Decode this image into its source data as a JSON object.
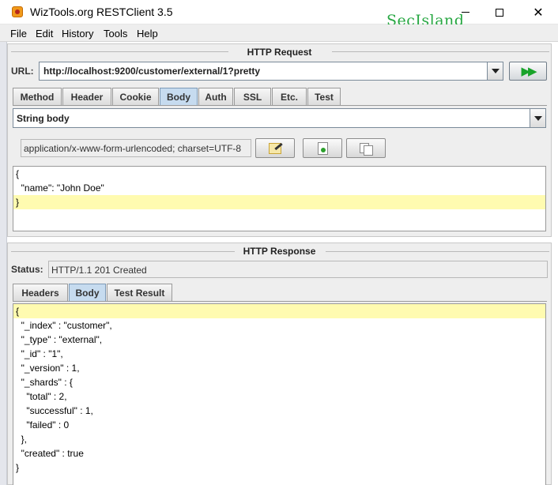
{
  "window": {
    "title": "WizTools.org RESTClient 3.5",
    "watermark": "SecIsland"
  },
  "menu": [
    "File",
    "Edit",
    "History",
    "Tools",
    "Help"
  ],
  "request": {
    "section_title": "HTTP Request",
    "url_label": "URL:",
    "url_value": "http://localhost:9200/customer/external/1?pretty",
    "go_icon": "double-right-arrow-icon",
    "tabs": [
      "Method",
      "Header",
      "Cookie",
      "Body",
      "Auth",
      "SSL",
      "Etc.",
      "Test"
    ],
    "active_tab": "Body",
    "body_type": "String body",
    "content_type": "application/x-www-form-urlencoded; charset=UTF-8",
    "body_lines": [
      "{",
      "  \"name\": \"John Doe\"",
      "}"
    ]
  },
  "response": {
    "section_title": "HTTP Response",
    "status_label": "Status:",
    "status_value": "HTTP/1.1 201 Created",
    "tabs": [
      "Headers",
      "Body",
      "Test Result"
    ],
    "active_tab": "Body",
    "body_lines": [
      "{",
      "  \"_index\" : \"customer\",",
      "  \"_type\" : \"external\",",
      "  \"_id\" : \"1\",",
      "  \"_version\" : 1,",
      "  \"_shards\" : {",
      "    \"total\" : 2,",
      "    \"successful\" : 1,",
      "    \"failed\" : 0",
      "  },",
      "  \"created\" : true",
      "}"
    ]
  },
  "colors": {
    "watermark": "#27a742",
    "active_tab": "#c6dbef",
    "line_highlight": "#fffbb0"
  }
}
